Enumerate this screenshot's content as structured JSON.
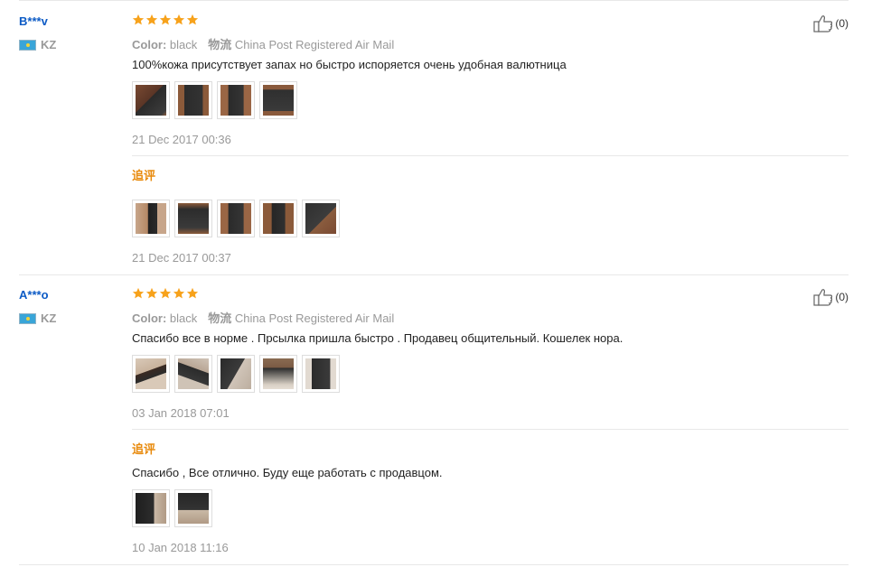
{
  "reviews": [
    {
      "user_name": "B***v",
      "country": "KZ",
      "rating": 5,
      "likes": "(0)",
      "color_label": "Color:",
      "color_value": "black",
      "shipping_label": "物流",
      "shipping_value": "China Post Registered Air Mail",
      "text": "100%кожа присутствует запах но быстро испоряется очень удобная валютница",
      "date": "21 Dec 2017 00:36",
      "followup_label": "追评",
      "followup_text": "",
      "followup_date": "21 Dec 2017 00:37"
    },
    {
      "user_name": "A***o",
      "country": "KZ",
      "rating": 5,
      "likes": "(0)",
      "color_label": "Color:",
      "color_value": "black",
      "shipping_label": "物流",
      "shipping_value": "China Post Registered Air Mail",
      "text": "Спасибо все в норме . Прсылка пришла быстро . Продавец общительный. Кошелек нора.",
      "date": "03 Jan 2018 07:01",
      "followup_label": "追评",
      "followup_text": "Спасибо , Все отлично. Буду еще работать с продавцом.",
      "followup_date": "10 Jan 2018 11:16"
    }
  ],
  "colors": {
    "user_link": "#0b5ac5",
    "star": "#f7a21b",
    "followup": "#e88a0c",
    "muted": "#999999"
  },
  "icons": {
    "star": "star-icon",
    "like": "thumbs-up-icon",
    "flag": "kz-flag-icon"
  }
}
